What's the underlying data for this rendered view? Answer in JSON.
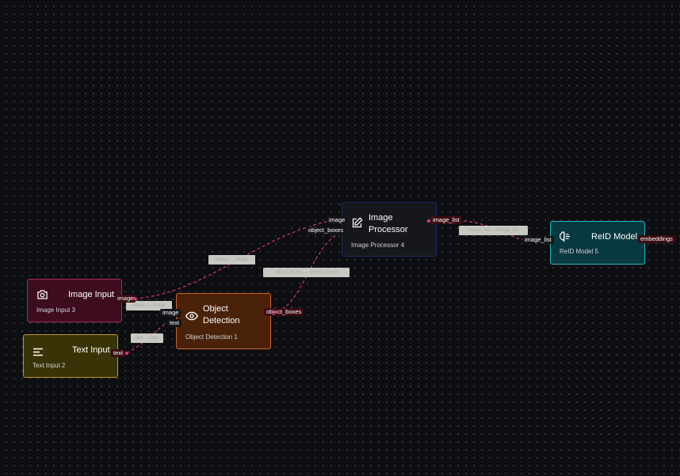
{
  "nodes": {
    "image_input": {
      "title": "Image Input",
      "subtitle": "Image Input 3",
      "icon": "camera-icon",
      "color": "#e8357a",
      "out_port": "image"
    },
    "text_input": {
      "title": "Text Input",
      "subtitle": "Text Input 2",
      "icon": "text-lines-icon",
      "color": "#c8a82c",
      "out_port": "text"
    },
    "object_detection": {
      "title": "Object Detection",
      "subtitle": "Object Detection 1",
      "icon": "eye-icon",
      "color": "#e07a2e",
      "in_ports": [
        "image",
        "text"
      ],
      "out_port": "object_boxes"
    },
    "image_processor": {
      "title": "Image Processor",
      "subtitle": "Image Processor 4",
      "icon": "edit-icon",
      "color": "#1f2a6b",
      "in_ports": [
        "image",
        "object_boxes"
      ],
      "out_port": "image_list"
    },
    "reid_model": {
      "title": "ReID Model",
      "subtitle": "ReID Model 5",
      "icon": "brain-icon",
      "color": "#1fb8c8",
      "in_port": "image_list",
      "out_port": "embeddings"
    }
  },
  "edge_labels": [
    "image → image",
    "image → image",
    "text → text",
    "object_boxes → object_boxes",
    "image_list → image_list"
  ],
  "colors": {
    "edge": "#e8357a",
    "background": "#0d0e11",
    "grid_dot": "#3a3d44"
  }
}
